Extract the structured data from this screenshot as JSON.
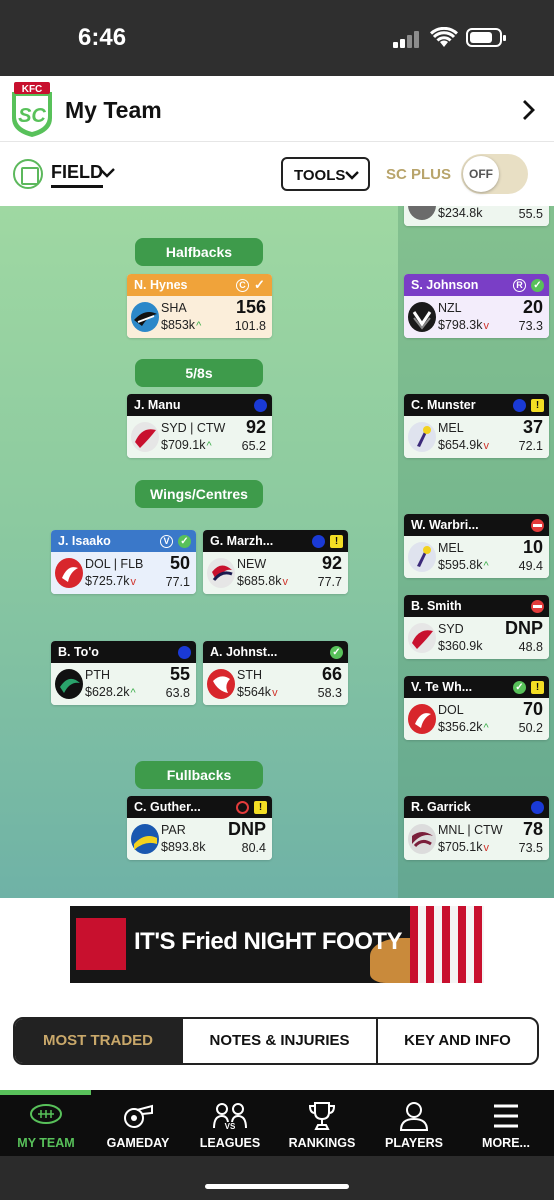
{
  "status_bar": {
    "time": "6:46"
  },
  "header": {
    "title": "My Team",
    "logo_text": "KFC SC"
  },
  "toolbar": {
    "field_label": "FIELD",
    "tools_label": "TOOLS",
    "scplus_label": "SC PLUS",
    "toggle_label": "OFF"
  },
  "positions": {
    "halfbacks": "Halfbacks",
    "five_eighths": "5/8s",
    "wings_centres": "Wings/Centres",
    "fullbacks": "Fullbacks"
  },
  "players": {
    "hynes": {
      "name": "N. Hynes",
      "team": "SHA",
      "price": "$853k",
      "trend": "up",
      "score": "156",
      "avg": "101.8",
      "badge": "C"
    },
    "manu": {
      "name": "J. Manu",
      "team": "SYD | CTW",
      "price": "$709.1k",
      "trend": "up",
      "score": "92",
      "avg": "65.2"
    },
    "isaako": {
      "name": "J. Isaako",
      "team": "DOL | FLB",
      "price": "$725.7k",
      "trend": "down",
      "score": "50",
      "avg": "77.1",
      "badge": "V"
    },
    "marzhew": {
      "name": "G. Marzh...",
      "team": "NEW",
      "price": "$685.8k",
      "trend": "down",
      "score": "92",
      "avg": "77.7"
    },
    "too": {
      "name": "B. To'o",
      "team": "PTH",
      "price": "$628.2k",
      "trend": "up",
      "score": "55",
      "avg": "63.8"
    },
    "johnston": {
      "name": "A. Johnst...",
      "team": "STH",
      "price": "$564k",
      "trend": "down",
      "score": "66",
      "avg": "58.3"
    },
    "gutherson": {
      "name": "C. Guther...",
      "team": "PAR",
      "price": "$893.8k",
      "trend": "none",
      "score": "DNP",
      "avg": "80.4"
    },
    "johnson": {
      "name": "S. Johnson",
      "team": "NZL",
      "price": "$798.3k",
      "trend": "down",
      "score": "20",
      "avg": "73.3",
      "badge": "R"
    },
    "munster": {
      "name": "C. Munster",
      "team": "MEL",
      "price": "$654.9k",
      "trend": "down",
      "score": "37",
      "avg": "72.1"
    },
    "warbrick": {
      "name": "W. Warbri...",
      "team": "MEL",
      "price": "$595.8k",
      "trend": "up",
      "score": "10",
      "avg": "49.4"
    },
    "smith": {
      "name": "B. Smith",
      "team": "SYD",
      "price": "$360.9k",
      "trend": "none",
      "score": "DNP",
      "avg": "48.8"
    },
    "tewhare": {
      "name": "V. Te Wh...",
      "team": "DOL",
      "price": "$356.2k",
      "trend": "up",
      "score": "70",
      "avg": "50.2"
    },
    "garrick": {
      "name": "R. Garrick",
      "team": "MNL | CTW",
      "price": "$705.1k",
      "trend": "down",
      "score": "78",
      "avg": "73.5"
    },
    "partial_top": {
      "price": "$234.8k",
      "avg": "55.5"
    }
  },
  "ad": {
    "text": "IT'S Fried NIGHT FOOTY"
  },
  "tabs": [
    {
      "label": "MOST TRADED",
      "active": true
    },
    {
      "label": "NOTES & INJURIES",
      "active": false
    },
    {
      "label": "KEY AND INFO",
      "active": false
    }
  ],
  "nav": {
    "my_team": "MY TEAM",
    "gameday": "GAMEDAY",
    "leagues": "LEAGUES",
    "rankings": "RANKINGS",
    "players": "PLAYERS",
    "more": "MORE..."
  },
  "colors": {
    "accent_green": "#58c15a",
    "gold": "#c9a86a",
    "captain": "#f0a33a",
    "vice": "#3a78c9",
    "reserve": "#7a3ec6"
  }
}
